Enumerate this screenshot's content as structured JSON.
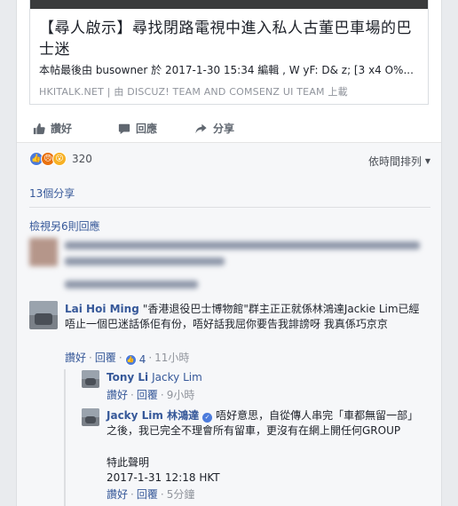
{
  "link": {
    "title": "【尋人啟示】尋找閉路電視中進入私人古董巴車場的巴士迷",
    "description": "本帖最後由 busowner 於 2017-1-30 15:34 編輯 , W yF: D& z; [3 x4 O%...",
    "source": "HKITALK.NET | 由 DISCUZ! TEAM AND COMSENZ UI TEAM 上載"
  },
  "actions": {
    "like": "讚好",
    "comment": "回應",
    "share": "分享"
  },
  "reactions": {
    "count": "320",
    "types": [
      "like-icon",
      "angry-icon",
      "wow-icon"
    ]
  },
  "sort_label": "依時間排列",
  "shares": "13個分享",
  "more_comments": "檢視另6則回應",
  "comments": [
    {
      "author": "Lai Hoi Ming",
      "text": "\"香港退役巴士博物館\"群主正正就係林鴻達Jackie Lim已經唔止一個巴迷話係佢有份，唔好話我屈你要告我誹謗呀 我真係巧京京",
      "like": "讚好",
      "reply": "回覆",
      "likes": "4",
      "time": "11小時"
    },
    {
      "author": "Tony Li",
      "mention": "Jacky Lim",
      "like": "讚好",
      "reply": "回覆",
      "time": "9小時"
    },
    {
      "author": "Jacky Lim 林鴻達",
      "text": "唔好意思，自從傳人串完「車都無留一部」之後，我已完全不理會所有留車，更沒有在網上開任何GROUP",
      "text2": "特此聲明",
      "text3": "2017-1-31 12:18 HKT",
      "like": "讚好",
      "reply": "回覆",
      "time": "5分鐘"
    }
  ],
  "colors": {
    "link": "#365899",
    "meta": "#90949c",
    "like_blue": "#4b7bdc"
  }
}
